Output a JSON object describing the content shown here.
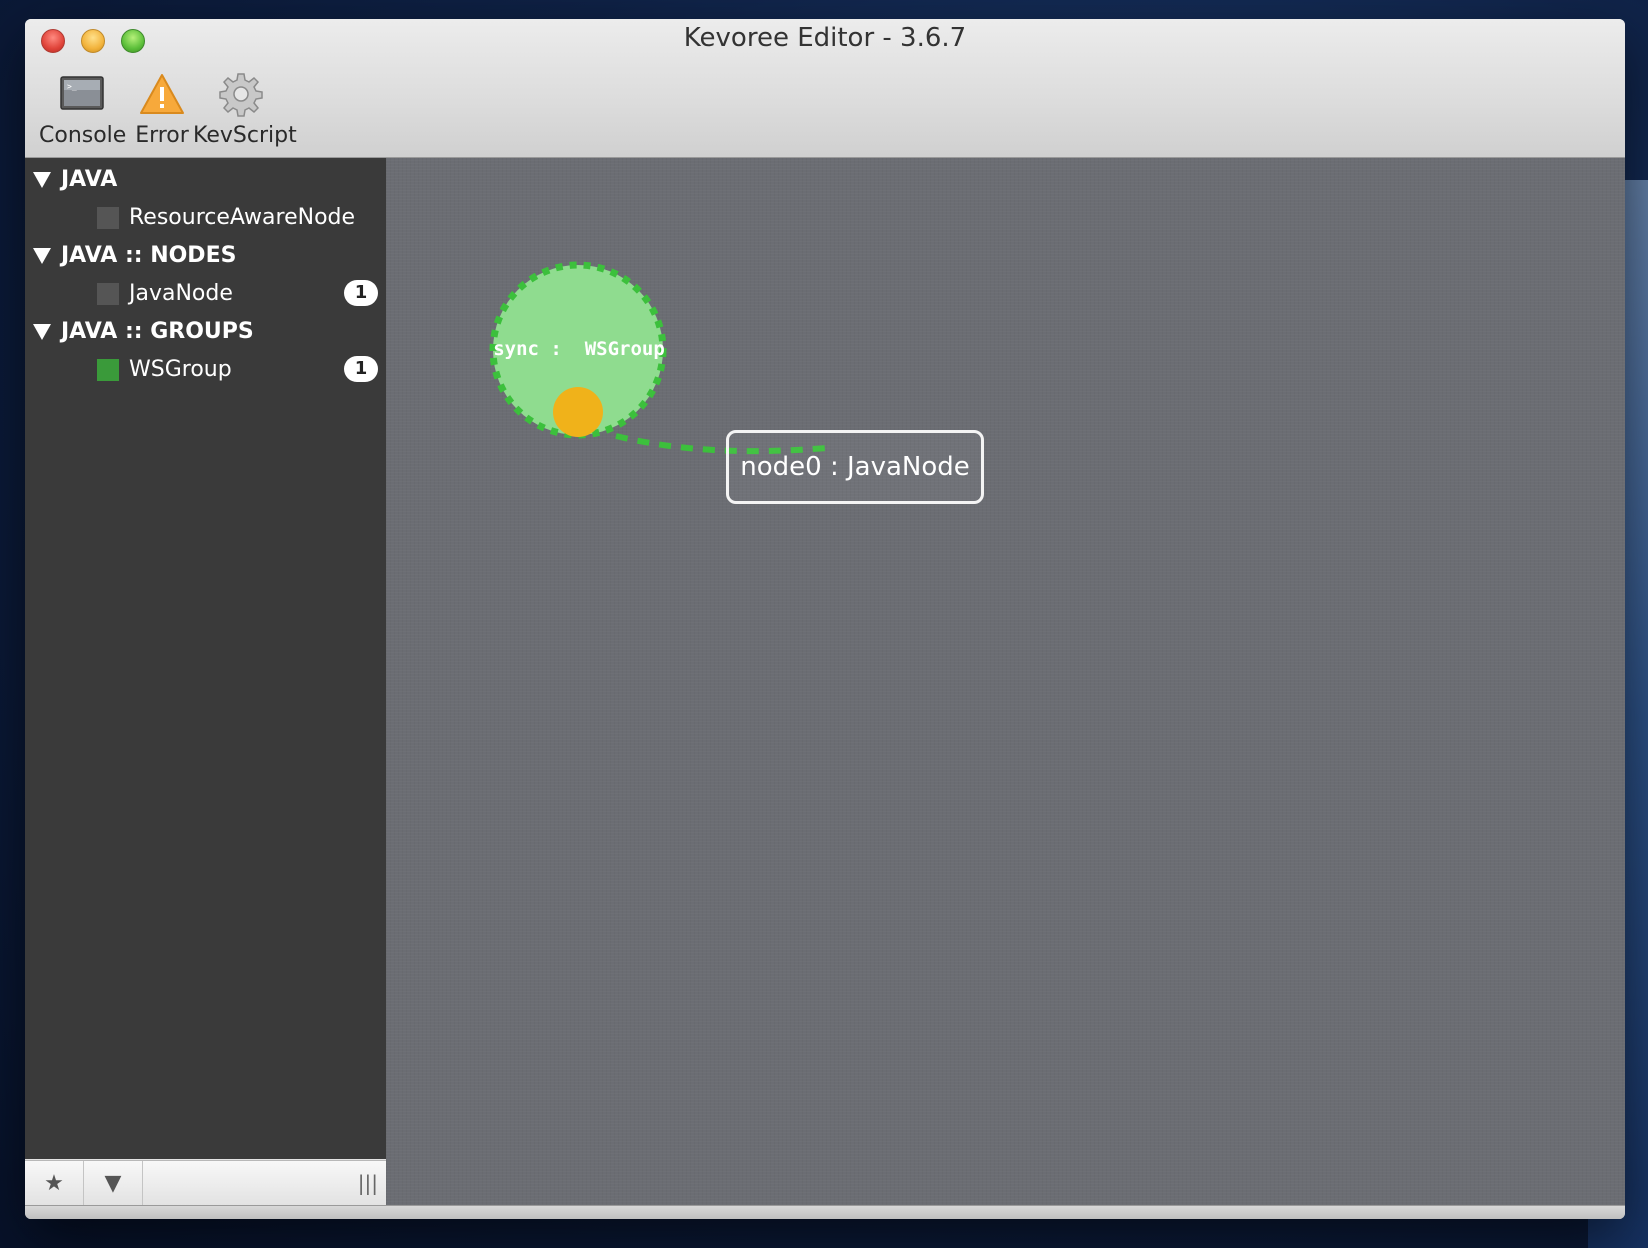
{
  "window": {
    "title": "Kevoree Editor - 3.6.7"
  },
  "toolbar": {
    "items": [
      {
        "label": "Console",
        "icon": "console-icon"
      },
      {
        "label": "Error",
        "icon": "warning-icon"
      },
      {
        "label": "KevScript",
        "icon": "gear-icon"
      }
    ]
  },
  "sidebar": {
    "groups": [
      {
        "label": "JAVA",
        "items": [
          {
            "label": "ResourceAwareNode",
            "color": "#555555",
            "count": ""
          }
        ]
      },
      {
        "label": "JAVA :: NODES",
        "items": [
          {
            "label": "JavaNode",
            "color": "#555555",
            "count": "1"
          }
        ]
      },
      {
        "label": "JAVA :: GROUPS",
        "items": [
          {
            "label": "WSGroup",
            "color": "#3a9a3a",
            "count": "1"
          }
        ]
      }
    ],
    "footer": {
      "star": "★",
      "dropdown": "▼",
      "grip": "|||"
    }
  },
  "canvas": {
    "group": {
      "label": "sync :  WSGroup",
      "fill": "#8fdc8f",
      "border": "#3cc03c",
      "port": "#f0b21a"
    },
    "node": {
      "label": "node0 : JavaNode"
    },
    "link_color": "#3cc03c"
  }
}
